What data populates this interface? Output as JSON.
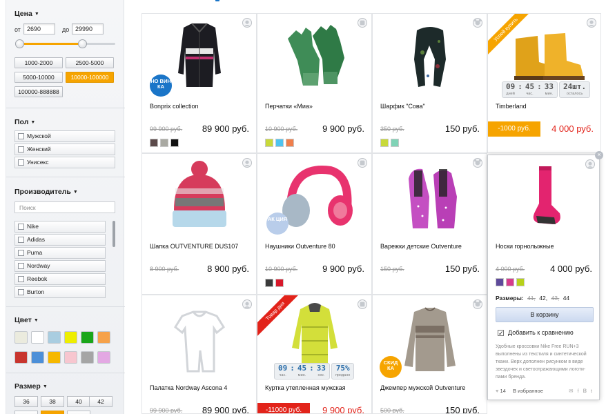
{
  "sidebar": {
    "price": {
      "title": "Цена",
      "from_label": "от",
      "from_value": "2690",
      "to_label": "до",
      "to_value": "29990",
      "ranges": [
        "1000-2000",
        "2500-5000",
        "5000-10000",
        "10000-100000",
        "100000-888888"
      ],
      "active_range": "10000-100000"
    },
    "gender": {
      "title": "Пол",
      "items": [
        "Мужской",
        "Женский",
        "Унисекс"
      ]
    },
    "brand": {
      "title": "Производитель",
      "search_placeholder": "Поиск",
      "items": [
        "Nike",
        "Adidas",
        "Puma",
        "Nordway",
        "Reebok",
        "Burton"
      ]
    },
    "color": {
      "title": "Цвет",
      "swatches": [
        "#ebebde",
        "#ffffff",
        "#a9cde0",
        "#eeee00",
        "#1aa61a",
        "#f6a24a",
        "#c8352e",
        "#4c8fd8",
        "#f6b800",
        "#f7c6cf",
        "#a5a5a5",
        "#e3a8e3"
      ]
    },
    "size": {
      "title": "Размер",
      "items": [
        "36",
        "38",
        "40",
        "42"
      ]
    }
  },
  "products": [
    {
      "name": "Bonprix collection",
      "old_price": "99 900 руб.",
      "price": "89 900 руб.",
      "colors": [
        "#5b4a4a",
        "#a9a9a2",
        "#111111"
      ],
      "badge": "НО ВИН КА",
      "badge_color": "#1a75c8"
    },
    {
      "name": "Перчатки «Миа»",
      "old_price": "10 900 руб.",
      "price": "9 900 руб.",
      "colors": [
        "#c8d93a",
        "#4fc3ef",
        "#f07f4c"
      ]
    },
    {
      "name": "Шарфик \"Сова\"",
      "old_price": "350 руб.",
      "price": "150 руб.",
      "colors": [
        "#c8d93a",
        "#7fd3b6"
      ]
    },
    {
      "name": "Timberland",
      "discount": "-1000 руб.",
      "price": "4 000 руб.",
      "corner_label": "Успей купить",
      "timer": {
        "values": [
          "09",
          "45",
          "33"
        ],
        "labels": [
          "дней",
          "час.",
          "мин."
        ],
        "stock": "24шт.",
        "stock_label": "осталось"
      }
    },
    {
      "name": "Шапка OUTVENTURE DUS107",
      "old_price": "8 900 руб.",
      "price": "8 900 руб."
    },
    {
      "name": "Наушники Outventure 80",
      "old_price": "10 900 руб.",
      "price": "9 900 руб.",
      "colors": [
        "#3a3a3a",
        "#d8182a"
      ],
      "badge": "АК ЦИЯ",
      "badge_color": "#b9cdea"
    },
    {
      "name": "Варежки детские Outventure",
      "old_price": "150 руб.",
      "price": "150 руб."
    },
    {
      "name": "Носки горнолыжные",
      "old_price": "4 000 руб.",
      "price": "4 000 руб.",
      "colors": [
        "#5e4a9a",
        "#d63b8c",
        "#b7d11a"
      ],
      "sizes_label": "Размеры:",
      "sizes": [
        {
          "v": "41,",
          "out": true
        },
        {
          "v": "42,",
          "out": false
        },
        {
          "v": "43,",
          "out": true
        },
        {
          "v": "44",
          "out": false
        }
      ],
      "cart_label": "В корзину",
      "compare_label": "Добавить к сравнению",
      "description": "Удобные кроссовки Nike Free RUN+3 выполнены из текстиля и синтетической ткани. Верх дополнен рисунком в виде звездочек и светоотражающими логоти-пами бренда.",
      "likes": "14",
      "favorites_label": "В избранное"
    },
    {
      "name": "Палатка Nordway Ascona 4",
      "old_price": "99 900 руб.",
      "price": "89 900 руб."
    },
    {
      "name": "Куртка утепленная мужская",
      "discount": "-11000 руб.",
      "price": "9 900 руб.",
      "corner_label": "Товар дня",
      "timer": {
        "values": [
          "09",
          "45",
          "33"
        ],
        "labels": [
          "час.",
          "мин.",
          "сек."
        ],
        "stock": "75%",
        "stock_label": "продано"
      }
    },
    {
      "name": "Джемпер мужской Outventure",
      "old_price": "500 руб.",
      "price": "150 руб.",
      "badge": "СКИД КА",
      "badge_color": "#f6a400"
    }
  ],
  "colors": {
    "accent": "#f6a400",
    "sale_red": "#e2231a",
    "link_blue": "#1a75c8"
  }
}
